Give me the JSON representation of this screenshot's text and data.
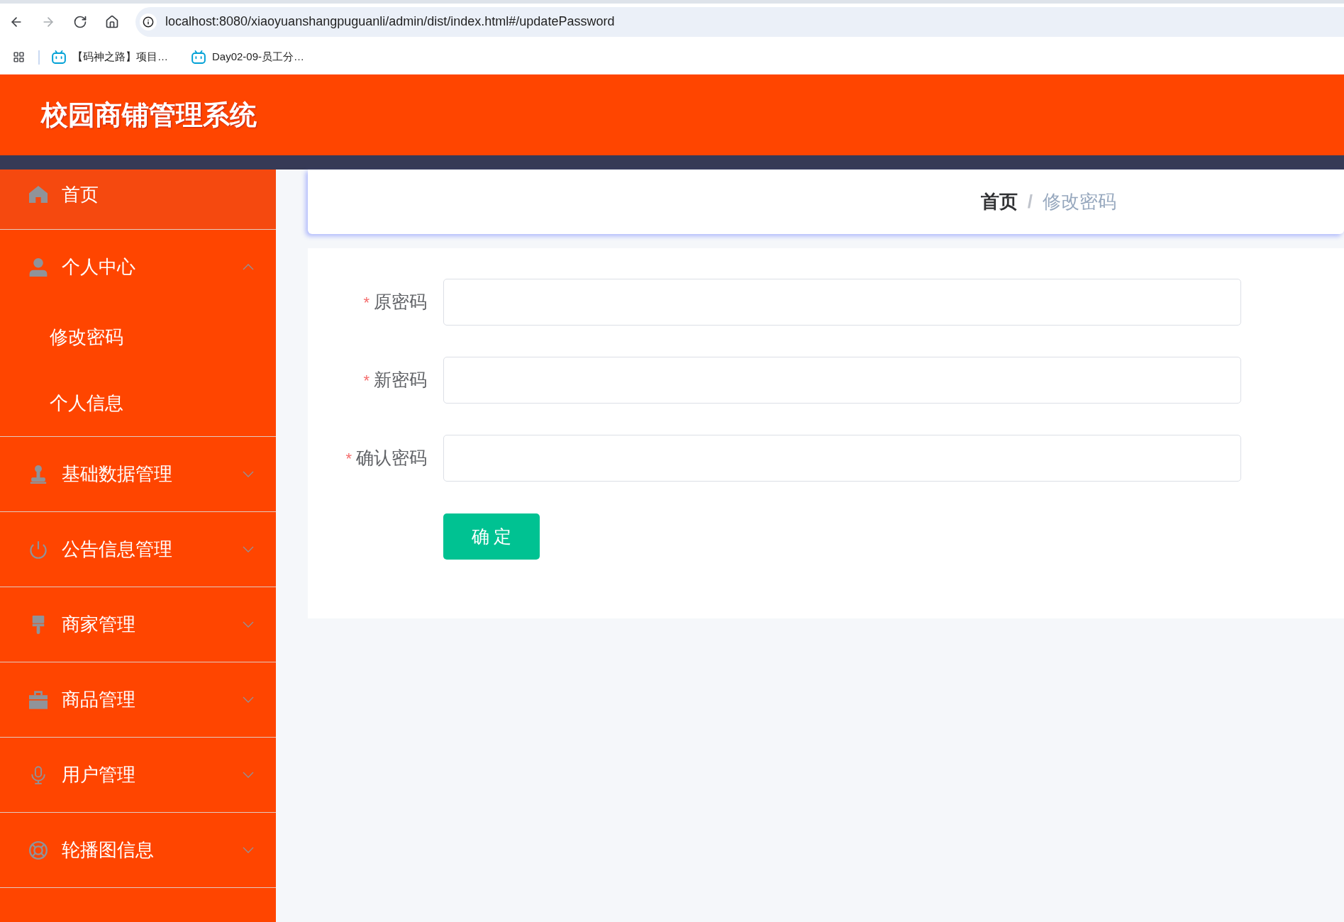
{
  "browser": {
    "nav": [
      {
        "kind": "back",
        "disabled": false
      },
      {
        "kind": "forward",
        "disabled": true
      },
      {
        "kind": "reload",
        "disabled": false
      },
      {
        "kind": "home",
        "disabled": false
      }
    ],
    "url": "localhost:8080/xiaoyuanshangpuguanli/admin/dist/index.html#/updatePassword",
    "bookmarks": [
      {
        "label": "【码神之路】项目…"
      },
      {
        "label": "Day02-09-员工分…"
      }
    ]
  },
  "header": {
    "title": "校园商铺管理系统"
  },
  "sidebar": {
    "items": [
      {
        "kind": "link",
        "label": "首页",
        "highlighted": true
      },
      {
        "kind": "submenu",
        "label": "个人中心",
        "highlighted": false,
        "expanded": true,
        "children": [
          {
            "label": "修改密码"
          },
          {
            "label": "个人信息"
          }
        ]
      },
      {
        "kind": "submenu",
        "label": "基础数据管理",
        "highlighted": false,
        "expanded": false
      },
      {
        "kind": "submenu",
        "label": "公告信息管理",
        "highlighted": false,
        "expanded": false
      },
      {
        "kind": "submenu",
        "label": "商家管理",
        "highlighted": false,
        "expanded": false
      },
      {
        "kind": "submenu",
        "label": "商品管理",
        "highlighted": false,
        "expanded": false
      },
      {
        "kind": "submenu",
        "label": "用户管理",
        "highlighted": false,
        "expanded": false
      },
      {
        "kind": "submenu",
        "label": "轮播图信息",
        "highlighted": false,
        "expanded": false
      }
    ]
  },
  "breadcrumb": {
    "separator": "/",
    "items": [
      {
        "label": "首页",
        "current": false
      },
      {
        "label": "修改密码",
        "current": true
      }
    ]
  },
  "form": {
    "fields": [
      {
        "required_mark": "*",
        "label": "原密码"
      },
      {
        "required_mark": "*",
        "label": "新密码"
      },
      {
        "required_mark": "*",
        "label": "确认密码"
      }
    ],
    "submit": "确 定"
  }
}
